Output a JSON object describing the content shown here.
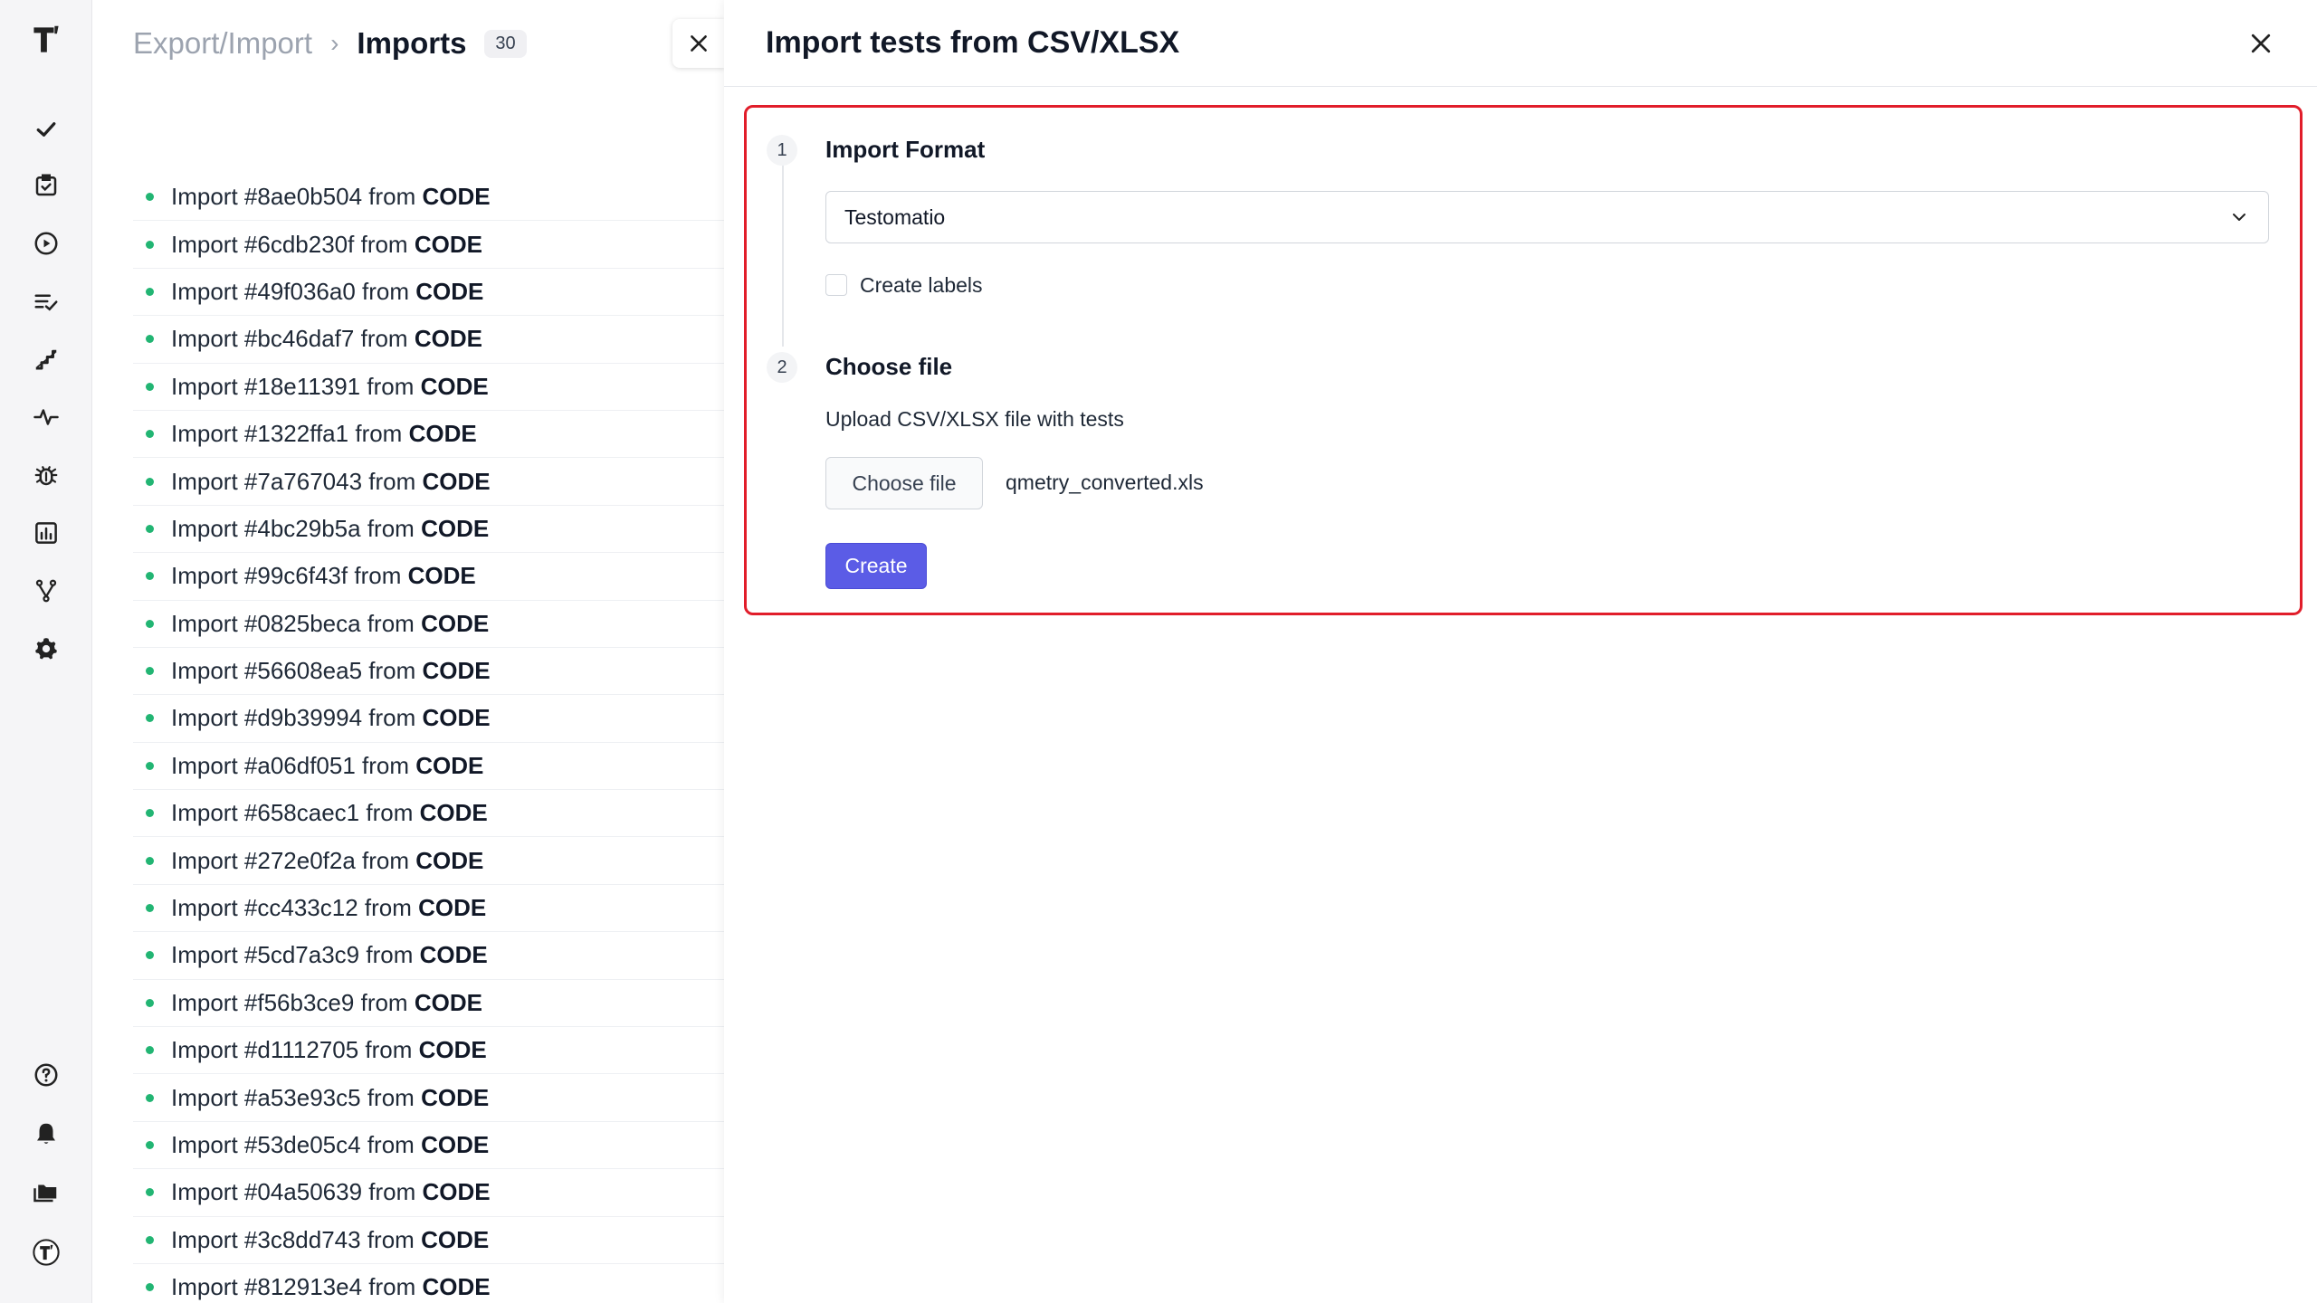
{
  "sidebar": {
    "logo": "testomatio-logo",
    "top_icons": [
      "check-icon",
      "clipboard-check-icon",
      "play-circle-icon",
      "list-check-icon",
      "steps-icon",
      "pulse-icon",
      "bug-icon",
      "bar-chart-icon",
      "branch-icon",
      "gear-icon"
    ],
    "bottom_icons": [
      "help-icon",
      "bell-icon",
      "folders-icon",
      "avatar-logo-icon"
    ]
  },
  "list_panel": {
    "breadcrumb_parent": "Export/Import",
    "breadcrumb_separator": "›",
    "breadcrumb_current": "Imports",
    "count": "30",
    "items": [
      {
        "id": "Import #8ae0b504",
        "from": "from",
        "source": "CODE"
      },
      {
        "id": "Import #6cdb230f",
        "from": "from",
        "source": "CODE"
      },
      {
        "id": "Import #49f036a0",
        "from": "from",
        "source": "CODE"
      },
      {
        "id": "Import #bc46daf7",
        "from": "from",
        "source": "CODE"
      },
      {
        "id": "Import #18e11391",
        "from": "from",
        "source": "CODE"
      },
      {
        "id": "Import #1322ffa1",
        "from": "from",
        "source": "CODE"
      },
      {
        "id": "Import #7a767043",
        "from": "from",
        "source": "CODE"
      },
      {
        "id": "Import #4bc29b5a",
        "from": "from",
        "source": "CODE"
      },
      {
        "id": "Import #99c6f43f",
        "from": "from",
        "source": "CODE"
      },
      {
        "id": "Import #0825beca",
        "from": "from",
        "source": "CODE"
      },
      {
        "id": "Import #56608ea5",
        "from": "from",
        "source": "CODE"
      },
      {
        "id": "Import #d9b39994",
        "from": "from",
        "source": "CODE"
      },
      {
        "id": "Import #a06df051",
        "from": "from",
        "source": "CODE"
      },
      {
        "id": "Import #658caec1",
        "from": "from",
        "source": "CODE"
      },
      {
        "id": "Import #272e0f2a",
        "from": "from",
        "source": "CODE"
      },
      {
        "id": "Import #cc433c12",
        "from": "from",
        "source": "CODE"
      },
      {
        "id": "Import #5cd7a3c9",
        "from": "from",
        "source": "CODE"
      },
      {
        "id": "Import #f56b3ce9",
        "from": "from",
        "source": "CODE"
      },
      {
        "id": "Import #d1112705",
        "from": "from",
        "source": "CODE"
      },
      {
        "id": "Import #a53e93c5",
        "from": "from",
        "source": "CODE"
      },
      {
        "id": "Import #53de05c4",
        "from": "from",
        "source": "CODE"
      },
      {
        "id": "Import #04a50639",
        "from": "from",
        "source": "CODE"
      },
      {
        "id": "Import #3c8dd743",
        "from": "from",
        "source": "CODE"
      },
      {
        "id": "Import #812913e4",
        "from": "from",
        "source": "CODE"
      }
    ]
  },
  "import_panel": {
    "title": "Import tests from CSV/XLSX",
    "step1": {
      "number": "1",
      "title": "Import Format",
      "select_value": "Testomatio",
      "checkbox_label": "Create labels",
      "checkbox_checked": false
    },
    "step2": {
      "number": "2",
      "title": "Choose file",
      "hint": "Upload CSV/XLSX file with tests",
      "choose_button": "Choose file",
      "file_name": "qmetry_converted.xls"
    },
    "create_button": "Create"
  },
  "colors": {
    "accent": "#5b5ce6",
    "status_dot": "#22b573",
    "highlight_border": "#e11d2a"
  }
}
